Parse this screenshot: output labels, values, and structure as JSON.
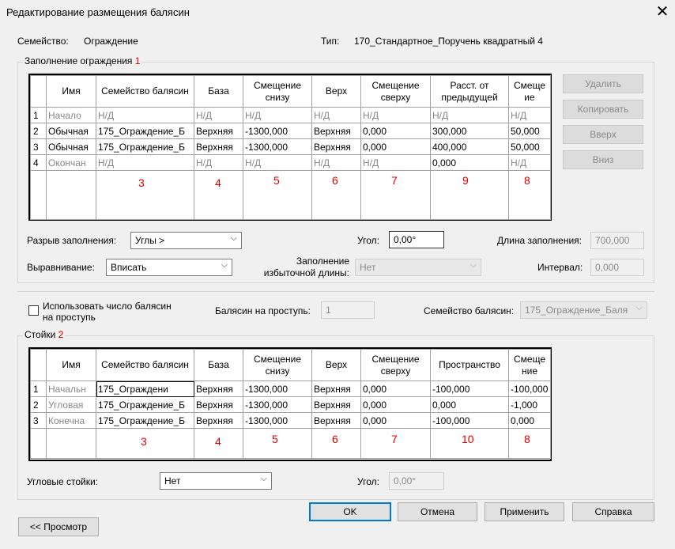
{
  "window": {
    "title": "Редактирование размещения балясин",
    "close_glyph": "✕"
  },
  "header": {
    "family_label": "Семейство:",
    "family_value": "Ограждение",
    "type_label": "Тип:",
    "type_value": "170_Стандартное_Поручень квадратный 4"
  },
  "fill": {
    "legend": "Заполнение ограждения",
    "legend_mark": "1",
    "columns": [
      "Имя",
      "Семейство балясин",
      "База",
      "Смещение снизу",
      "Верх",
      "Смещение сверху",
      "Расст. от предыдущей",
      "Смеще ие"
    ],
    "rows": [
      {
        "n": "1",
        "cells": [
          "Начало",
          "Н/Д",
          "Н/Д",
          "Н/Д",
          "Н/Д",
          "Н/Д",
          "Н/Д",
          "Н/Д"
        ]
      },
      {
        "n": "2",
        "cells": [
          "Обычная",
          "175_Ограждение_Б",
          "Верхняя",
          "-1300,000",
          "Верхняя",
          "0,000",
          "300,000",
          "50,000"
        ]
      },
      {
        "n": "3",
        "cells": [
          "Обычная",
          "175_Ограждение_Б",
          "Верхняя",
          "-1300,000",
          "Верхняя",
          "0,000",
          "400,000",
          "50,000"
        ]
      },
      {
        "n": "4",
        "cells": [
          "Окончан",
          "Н/Д",
          "Н/Д",
          "Н/Д",
          "Н/Д",
          "Н/Д",
          "0,000",
          "Н/Д"
        ]
      }
    ],
    "annotations": [
      "3",
      "4",
      "5",
      "6",
      "7",
      "9",
      "8"
    ],
    "buttons": {
      "delete": "Удалить",
      "copy": "Копировать",
      "up": "Вверх",
      "down": "Вниз"
    },
    "break_label": "Разрыв заполнения:",
    "break_value": "Углы >",
    "angle_label": "Угол:",
    "angle_value": "0,00°",
    "length_label": "Длина заполнения:",
    "length_value": "700,000",
    "align_label": "Выравнивание:",
    "align_value": "Вписать",
    "excess_label_1": "Заполнение",
    "excess_label_2": "избыточной длины:",
    "excess_value": "Нет",
    "interval_label": "Интервал:",
    "interval_value": "0,000"
  },
  "tread": {
    "checkbox_label_1": "Использовать число балясин",
    "checkbox_label_2": "на проступь",
    "per_tread_label": "Балясин на проступь:",
    "per_tread_value": "1",
    "family_label": "Семейство балясин:",
    "family_value": "175_Ограждение_Баля"
  },
  "posts": {
    "legend": "Стойки",
    "legend_mark": "2",
    "columns": [
      "Имя",
      "Семейство балясин",
      "База",
      "Смещение снизу",
      "Верх",
      "Смещение сверху",
      "Пространство",
      "Смеще ние"
    ],
    "rows": [
      {
        "n": "1",
        "cells": [
          "Начальн",
          "175_Ограждени",
          "Верхняя",
          "-1300,000",
          "Верхняя",
          "0,000",
          "-100,000",
          "-100,000"
        ]
      },
      {
        "n": "2",
        "cells": [
          "Угловая",
          "175_Ограждение_Б",
          "Верхняя",
          "-1300,000",
          "Верхняя",
          "0,000",
          "0,000",
          "-1,000"
        ]
      },
      {
        "n": "3",
        "cells": [
          "Конечна",
          "175_Ограждение_Б",
          "Верхняя",
          "-1300,000",
          "Верхняя",
          "0,000",
          "-100,000",
          "0,000"
        ]
      }
    ],
    "annotations": [
      "3",
      "4",
      "5",
      "6",
      "7",
      "10",
      "8"
    ],
    "corner_label": "Угловые стойки:",
    "corner_value": "Нет",
    "angle_label": "Угол:",
    "angle_value": "0,00°"
  },
  "footer": {
    "ok": "OK",
    "cancel": "Отмена",
    "apply": "Применить",
    "help": "Справка",
    "preview": "<< Просмотр"
  },
  "icons": {
    "dropdown": "chevron-down-icon",
    "close": "close-icon"
  }
}
